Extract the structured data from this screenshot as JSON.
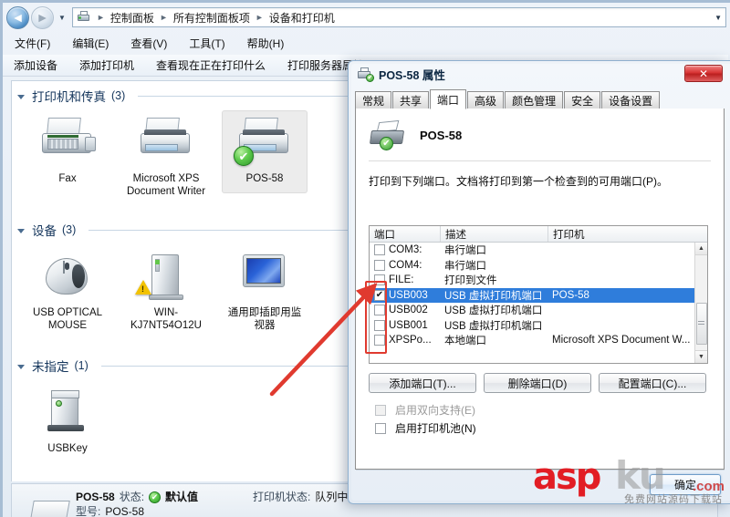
{
  "explorer": {
    "address": {
      "crumbs": [
        "控制面板",
        "所有控制面板项",
        "设备和打印机"
      ],
      "icon": "printer-icon",
      "back_icon": "back-arrow-icon",
      "forward_icon": "forward-arrow-icon",
      "recent_icon": "chevron-down-icon",
      "dropdown_icon": "chevron-down-icon"
    },
    "menus": [
      "文件(F)",
      "编辑(E)",
      "查看(V)",
      "工具(T)",
      "帮助(H)"
    ],
    "commands": [
      "添加设备",
      "添加打印机",
      "查看现在正在打印什么",
      "打印服务器属性"
    ],
    "groups": [
      {
        "name": "打印机和传真",
        "count": "(3)",
        "items": [
          {
            "label": "Fax",
            "icon": "fax-printer-icon",
            "selected": false,
            "badge": "none"
          },
          {
            "label": "Microsoft XPS Document Writer",
            "icon": "printer-icon",
            "selected": false,
            "badge": "none"
          },
          {
            "label": "POS-58",
            "icon": "printer-icon",
            "selected": true,
            "badge": "default-check"
          }
        ]
      },
      {
        "name": "设备",
        "count": "(3)",
        "items": [
          {
            "label": "USB OPTICAL MOUSE",
            "icon": "mouse-icon",
            "selected": false,
            "badge": "none"
          },
          {
            "label": "WIN-KJ7NT54O12U",
            "icon": "computer-tower-icon",
            "selected": false,
            "badge": "warning"
          },
          {
            "label": "通用即插即用监视器",
            "icon": "monitor-icon",
            "selected": false,
            "badge": "none"
          }
        ]
      },
      {
        "name": "未指定",
        "count": "(1)",
        "items": [
          {
            "label": "USBKey",
            "icon": "usb-key-icon",
            "selected": false,
            "badge": "none"
          }
        ]
      }
    ],
    "details": {
      "name": "POS-58",
      "status_label": "状态:",
      "status_value": "默认值",
      "model_label": "型号:",
      "model_value": "POS-58",
      "printer_state_label": "打印机状态:",
      "printer_state_value": "队列中"
    }
  },
  "dialog": {
    "title": "POS-58 属性",
    "close_label": "✕",
    "tabs": [
      {
        "label": "常规",
        "active": false
      },
      {
        "label": "共享",
        "active": false
      },
      {
        "label": "端口",
        "active": true
      },
      {
        "label": "高级",
        "active": false
      },
      {
        "label": "颜色管理",
        "active": false
      },
      {
        "label": "安全",
        "active": false
      },
      {
        "label": "设备设置",
        "active": false
      }
    ],
    "printer_name": "POS-58",
    "description": "打印到下列端口。文档将打印到第一个检查到的可用端口(P)。",
    "list": {
      "headers": [
        "端口",
        "描述",
        "打印机"
      ],
      "rows": [
        {
          "checked": false,
          "enabled": true,
          "port": "COM3:",
          "desc": "串行端口",
          "printer": "",
          "selected": false
        },
        {
          "checked": false,
          "enabled": true,
          "port": "COM4:",
          "desc": "串行端口",
          "printer": "",
          "selected": false
        },
        {
          "checked": false,
          "enabled": true,
          "port": "FILE:",
          "desc": "打印到文件",
          "printer": "",
          "selected": false
        },
        {
          "checked": true,
          "enabled": true,
          "port": "USB003",
          "desc": "USB 虚拟打印机端口",
          "printer": "POS-58",
          "selected": true
        },
        {
          "checked": false,
          "enabled": true,
          "port": "USB002",
          "desc": "USB 虚拟打印机端口",
          "printer": "",
          "selected": false
        },
        {
          "checked": false,
          "enabled": true,
          "port": "USB001",
          "desc": "USB 虚拟打印机端口",
          "printer": "",
          "selected": false
        },
        {
          "checked": false,
          "enabled": true,
          "port": "XPSPo...",
          "desc": "本地端口",
          "printer": "Microsoft XPS Document W...",
          "selected": false
        }
      ],
      "checked_glyph": "✔"
    },
    "buttons": {
      "add_port": "添加端口(T)...",
      "delete_port": "删除端口(D)",
      "configure_port": "配置端口(C)...",
      "ok": "确定"
    },
    "checkboxes": {
      "bidirectional": "启用双向支持(E)",
      "pool": "启用打印机池(N)"
    },
    "selection_color": "#2f7ddb"
  },
  "annotation": {
    "highlight_color": "#e03a2f",
    "arrow": "red-arrow-icon",
    "box": "red-highlight-box"
  },
  "watermark": {
    "brand_red": "asp",
    "brand_gray": "ku",
    "domain": ".com",
    "subtitle": "免费网站源码下载站"
  }
}
